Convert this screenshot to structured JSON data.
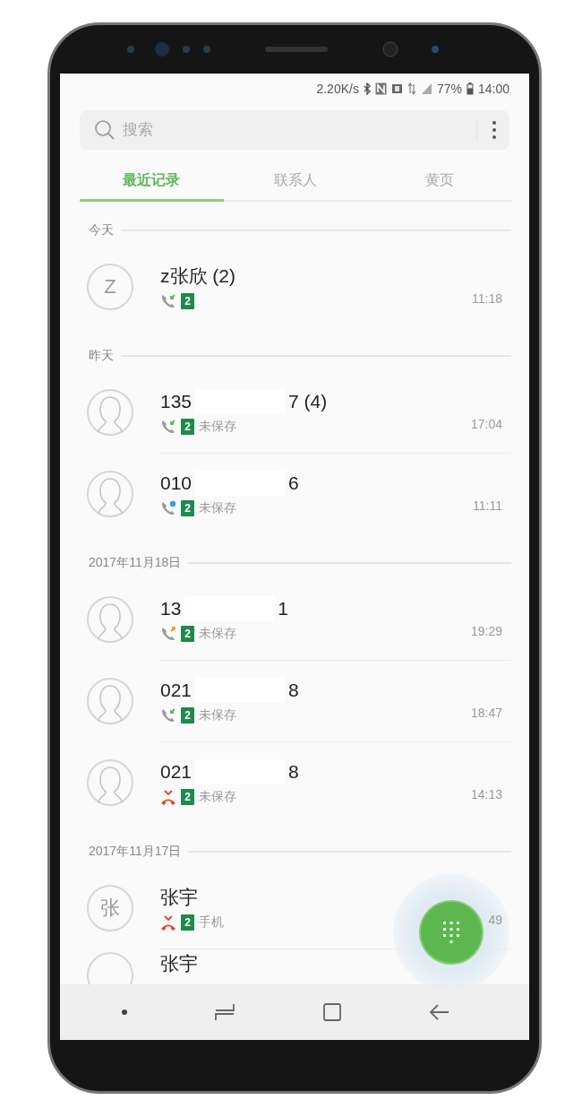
{
  "status_bar": {
    "speed": "2.20K/s",
    "battery": "77%",
    "time": "14:00"
  },
  "search": {
    "placeholder": "搜索"
  },
  "tabs": [
    {
      "label": "最近记录",
      "selected": true
    },
    {
      "label": "联系人",
      "selected": false
    },
    {
      "label": "黄页",
      "selected": false
    }
  ],
  "sections": [
    {
      "date": "今天",
      "calls": [
        {
          "avatar": {
            "kind": "letter",
            "letter": "Z"
          },
          "name_parts": [
            "z张欣 (2)"
          ],
          "call_icon": {
            "kind": "incoming"
          },
          "sim": "2",
          "time": "11:18"
        }
      ]
    },
    {
      "date": "昨天",
      "calls": [
        {
          "avatar": {
            "kind": "silhouette"
          },
          "name_parts": [
            "135",
            "7 (4)"
          ],
          "call_icon": {
            "kind": "incoming"
          },
          "sim": "2",
          "label": "未保存",
          "time": "17:04"
        },
        {
          "avatar": {
            "kind": "silhouette"
          },
          "name_parts": [
            "010",
            "6"
          ],
          "call_icon": {
            "kind": "dot"
          },
          "sim": "2",
          "label": "未保存",
          "time": "11:11"
        }
      ]
    },
    {
      "date": "2017年11月18日",
      "calls": [
        {
          "avatar": {
            "kind": "silhouette"
          },
          "name_parts": [
            "13",
            "1"
          ],
          "call_icon": {
            "kind": "outgoing"
          },
          "sim": "2",
          "label": "未保存",
          "time": "19:29"
        },
        {
          "avatar": {
            "kind": "silhouette"
          },
          "name_parts": [
            "021",
            "8"
          ],
          "call_icon": {
            "kind": "incoming"
          },
          "sim": "2",
          "label": "未保存",
          "time": "18:47"
        },
        {
          "avatar": {
            "kind": "silhouette"
          },
          "name_parts": [
            "021",
            "8"
          ],
          "call_icon": {
            "kind": "missed"
          },
          "sim": "2",
          "label": "未保存",
          "time": "14:13"
        }
      ]
    },
    {
      "date": "2017年11月17日",
      "calls": [
        {
          "avatar": {
            "kind": "letter",
            "letter": "张"
          },
          "name_parts": [
            "张宇"
          ],
          "call_icon": {
            "kind": "missed"
          },
          "sim": "2",
          "label": "手机",
          "time": "49"
        },
        {
          "avatar": {
            "kind": "circle"
          },
          "name_parts": [
            "张宇"
          ]
        }
      ]
    }
  ]
}
